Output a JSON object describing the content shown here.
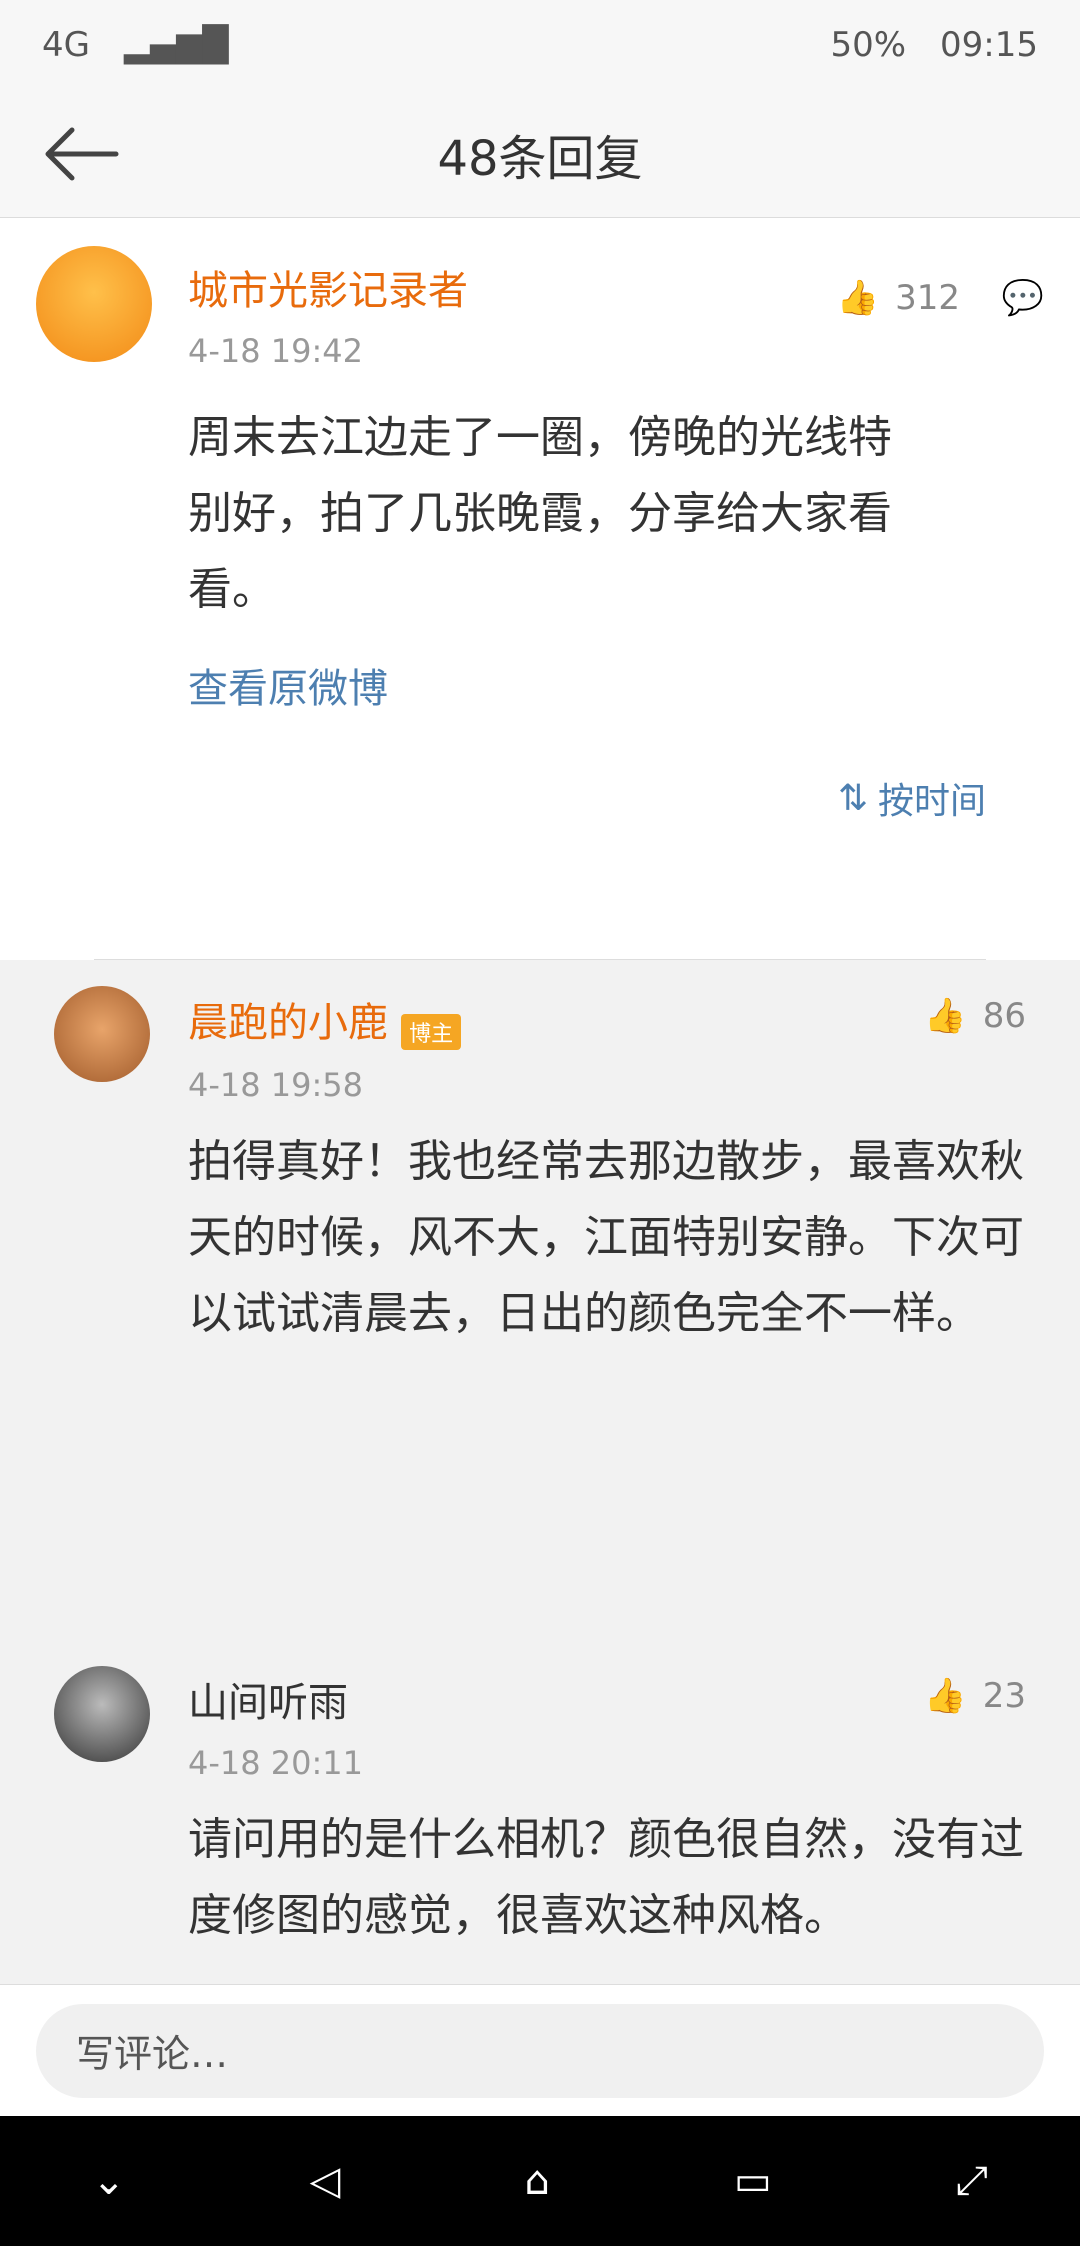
{
  "status": {
    "network": "4G",
    "battery": "50%",
    "time": "09:15"
  },
  "header": {
    "title": "48条回复"
  },
  "post": {
    "author": "城市光影记录者",
    "time": "4-18 19:42",
    "likes": "312",
    "content": "周末去江边走了一圈，傍晚的光线特别好，拍了几张晚霞，分享给大家看看。",
    "link_label": "查看原微博",
    "sort_label": "按时间"
  },
  "comments": [
    {
      "name": "晨跑的小鹿",
      "badge": "博主",
      "time": "4-18 19:58",
      "likes": "86",
      "content": "拍得真好！我也经常去那边散步，最喜欢秋天的时候，风不大，江面特别安静。下次可以试试清晨去，日出的颜色完全不一样。"
    },
    {
      "name": "山间听雨",
      "badge": "",
      "time": "4-18 20:11",
      "likes": "23",
      "content": "请问用的是什么相机？颜色很自然，没有过度修图的感觉，很喜欢这种风格。"
    }
  ],
  "reply": {
    "placeholder": "写评论…"
  },
  "colors": {
    "accent": "#e86b0c",
    "link": "#4d7fb0"
  }
}
